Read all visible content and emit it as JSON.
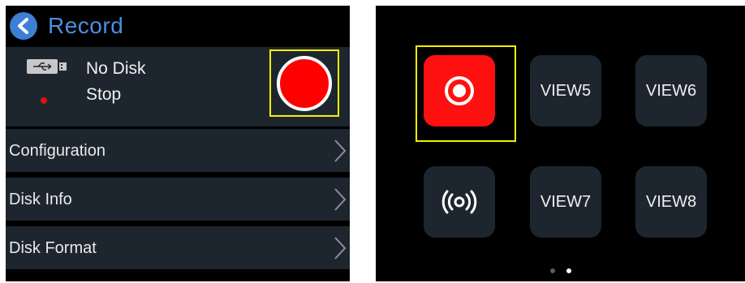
{
  "record_screen": {
    "title": "Record",
    "disk_status": "No Disk",
    "record_status": "Stop",
    "menu": [
      {
        "label": "Configuration"
      },
      {
        "label": "Disk Info"
      },
      {
        "label": "Disk Format"
      }
    ]
  },
  "view_screen": {
    "tiles": [
      {
        "id": "record",
        "icon": "record-icon",
        "label": ""
      },
      {
        "id": "view5",
        "label": "VIEW5"
      },
      {
        "id": "view6",
        "label": "VIEW6"
      },
      {
        "id": "broadcast",
        "icon": "broadcast-icon",
        "label": ""
      },
      {
        "id": "view7",
        "label": "VIEW7"
      },
      {
        "id": "view8",
        "label": "VIEW8"
      }
    ],
    "page_indicator": {
      "pages": 2,
      "current": 2
    }
  },
  "colors": {
    "accent_blue": "#3c7fd4",
    "record_red": "#ff0000",
    "highlight_yellow": "#f5f000",
    "panel_bg": "#1d262e"
  }
}
